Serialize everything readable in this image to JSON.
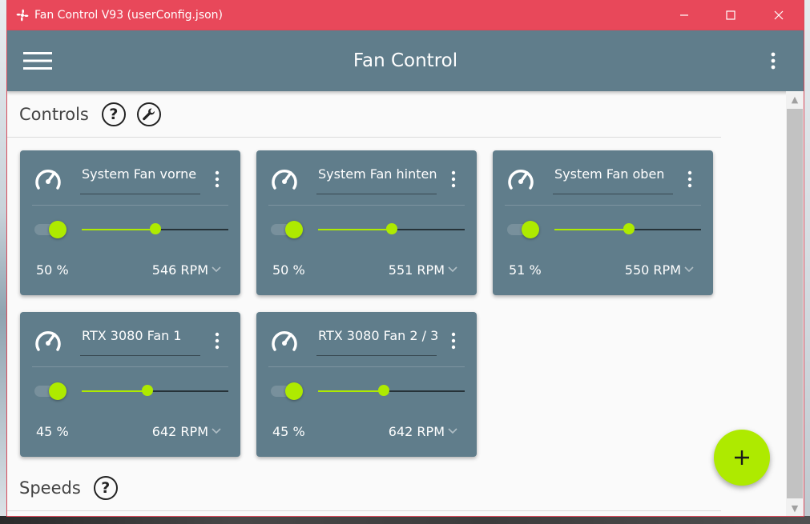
{
  "window": {
    "title": "Fan Control V93 (userConfig.json)",
    "accent_color": "#e8485a"
  },
  "appbar": {
    "title": "Fan Control",
    "color": "#607d8b"
  },
  "controls_section": {
    "title": "Controls",
    "help_label": "?"
  },
  "speeds_section": {
    "title": "Speeds",
    "help_label": "?"
  },
  "cards": [
    {
      "name": "System Fan vorne",
      "enabled": true,
      "percent": 50,
      "percent_label": "50 %",
      "rpm_label": "546 RPM"
    },
    {
      "name": "System Fan hinten",
      "enabled": true,
      "percent": 50,
      "percent_label": "50 %",
      "rpm_label": "551 RPM"
    },
    {
      "name": "System Fan oben",
      "enabled": true,
      "percent": 51,
      "percent_label": "51 %",
      "rpm_label": "550 RPM"
    },
    {
      "name": "RTX 3080 Fan 1",
      "enabled": true,
      "percent": 45,
      "percent_label": "45 %",
      "rpm_label": "642 RPM"
    },
    {
      "name": "RTX 3080 Fan 2 / 3",
      "enabled": true,
      "percent": 45,
      "percent_label": "45 %",
      "rpm_label": "642 RPM"
    }
  ],
  "colors": {
    "card": "#607d8b",
    "active": "#aeea00"
  },
  "fab": {
    "icon": "plus-icon",
    "label": "+"
  }
}
